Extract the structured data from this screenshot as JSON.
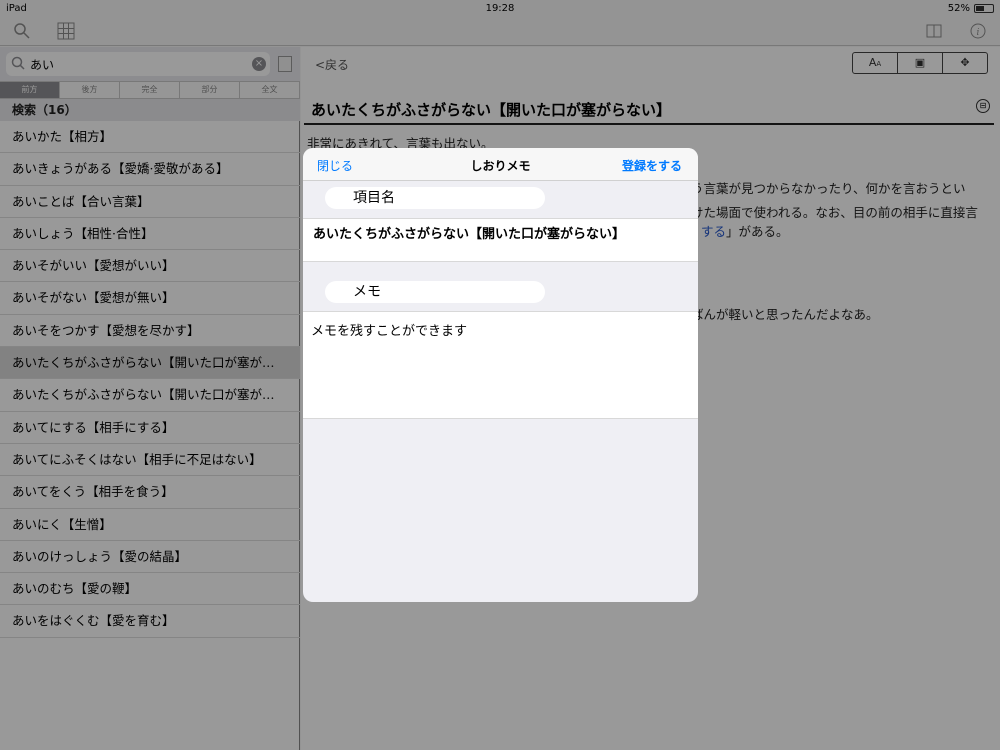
{
  "status": {
    "device": "iPad",
    "time": "19:28",
    "battery": "52%",
    "battery_fraction": 0.52
  },
  "toolbar": {
    "search_icon": "search-icon",
    "grid_icon": "grid-icon",
    "book_icon": "book-icon",
    "info_icon": "info-icon"
  },
  "search": {
    "value": "あい"
  },
  "segments": [
    {
      "label": "前方",
      "active": true
    },
    {
      "label": "後方",
      "active": false
    },
    {
      "label": "完全",
      "active": false
    },
    {
      "label": "部分",
      "active": false
    },
    {
      "label": "全文",
      "active": false
    }
  ],
  "results_count": "検索（16）",
  "results": [
    {
      "text": "あいかた【相方】",
      "selected": false
    },
    {
      "text": "あいきょうがある【愛嬌·愛敬がある】",
      "selected": false
    },
    {
      "text": "あいことば【合い言葉】",
      "selected": false
    },
    {
      "text": "あいしょう【相性·合性】",
      "selected": false
    },
    {
      "text": "あいそがいい【愛想がいい】",
      "selected": false
    },
    {
      "text": "あいそがない【愛想が無い】",
      "selected": false
    },
    {
      "text": "あいそをつかす【愛想を尽かす】",
      "selected": false
    },
    {
      "text": "あいたくちがふさがらない【開いた口が塞が…",
      "selected": true
    },
    {
      "text": "あいたくちがふさがらない【開いた口が塞が…",
      "selected": false
    },
    {
      "text": "あいてにする【相手にする】",
      "selected": false
    },
    {
      "text": "あいてにふそくはない【相手に不足はない】",
      "selected": false
    },
    {
      "text": "あいてをくう【相手を食う】",
      "selected": false
    },
    {
      "text": "あいにく【生憎】",
      "selected": false
    },
    {
      "text": "あいのけっしょう【愛の結晶】",
      "selected": false
    },
    {
      "text": "あいのむち【愛の鞭】",
      "selected": false
    },
    {
      "text": "あいをはぐくむ【愛を育む】",
      "selected": false
    }
  ],
  "detail": {
    "back": "<戻る",
    "title": "あいたくちがふさがらない【開いた口が塞がらない】",
    "line1": "非常にあきれて、言葉も出ない。",
    "line2": "う言葉が見つからなかったり、何かを言おうとい",
    "line3": "けた場面で使われる。なお、目の前の相手に直接言",
    "line4_link": "する",
    "line4_rest": "」がある。",
    "line5": "ばんが軽いと思ったんだよなあ。"
  },
  "modal": {
    "close": "閉じる",
    "title": "しおりメモ",
    "save": "登録をする",
    "item_label": "項目名",
    "item_value": "あいたくちがふさがらない【開いた口が塞がらない】",
    "memo_label": "メモ",
    "memo_value": "メモを残すことができます"
  }
}
